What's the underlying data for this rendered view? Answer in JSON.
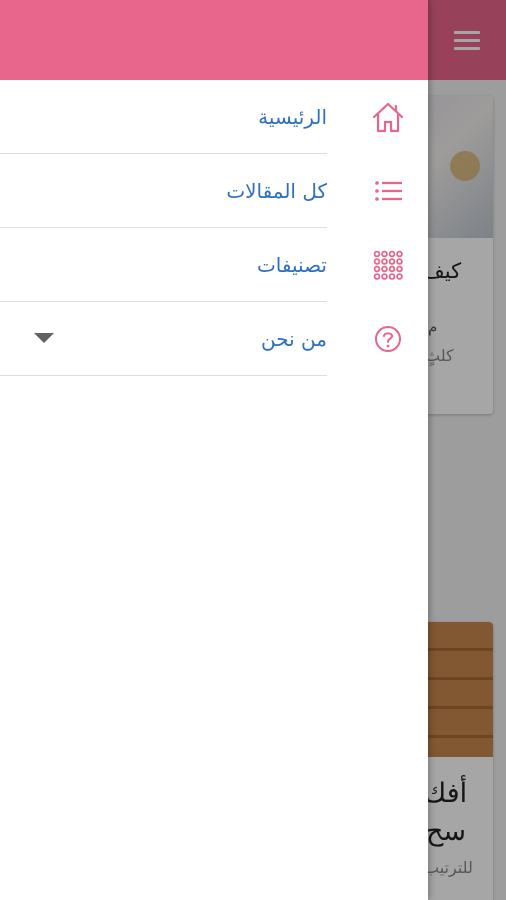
{
  "colors": {
    "brand_pink": "#e8668b",
    "link_blue": "#2f6fbf",
    "icon_pink": "#e8668b",
    "divider": "#dedede"
  },
  "background_page": {
    "card1": {
      "title_partial": "كيف",
      "meta_partial": "م",
      "category_partial": "كلثٍ"
    },
    "card2": {
      "title_line1_partial": "أفك",
      "title_line2_partial": "سح",
      "sub_partial": "للترتيب"
    }
  },
  "drawer": {
    "items": [
      {
        "label": "الرئيسية",
        "icon": "home-icon"
      },
      {
        "label": "كل المقالات",
        "icon": "list-icon"
      },
      {
        "label": "تصنيفات",
        "icon": "grid-dots-icon"
      },
      {
        "label": "من نحن",
        "icon": "help-circle-icon",
        "expandable": true
      }
    ]
  }
}
